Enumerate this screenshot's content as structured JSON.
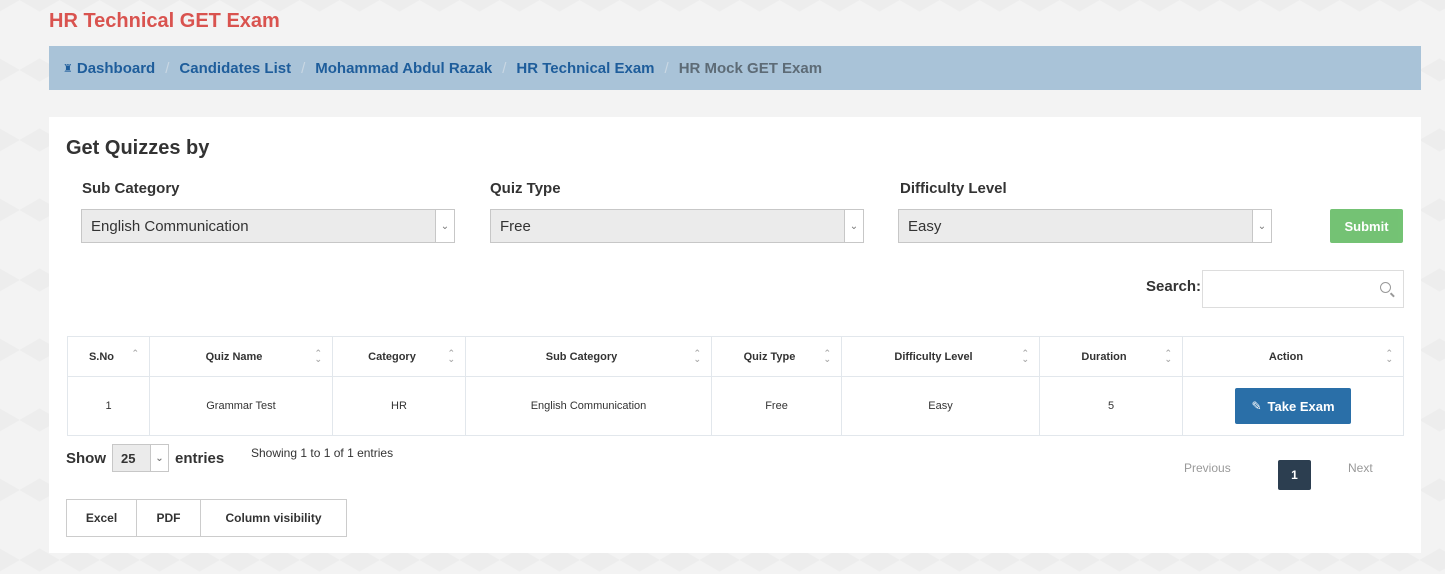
{
  "page": {
    "title": "HR Technical GET Exam"
  },
  "breadcrumb": {
    "items": [
      "Dashboard",
      "Candidates List",
      "Mohammad Abdul Razak",
      "HR Technical Exam"
    ],
    "active": "HR Mock GET Exam"
  },
  "filters": {
    "heading": "Get Quizzes by",
    "sub_category": {
      "label": "Sub Category",
      "value": "English Communication"
    },
    "quiz_type": {
      "label": "Quiz Type",
      "value": "Free"
    },
    "difficulty": {
      "label": "Difficulty Level",
      "value": "Easy"
    },
    "submit_label": "Submit"
  },
  "search": {
    "label": "Search:",
    "value": ""
  },
  "table": {
    "headers": [
      "S.No",
      "Quiz Name",
      "Category",
      "Sub Category",
      "Quiz Type",
      "Difficulty Level",
      "Duration",
      "Action"
    ],
    "rows": [
      {
        "sno": "1",
        "quiz_name": "Grammar Test",
        "category": "HR",
        "sub_category": "English Communication",
        "quiz_type": "Free",
        "difficulty": "Easy",
        "duration": "5",
        "action": "Take Exam"
      }
    ]
  },
  "footer": {
    "show_label": "Show",
    "entries_value": "25",
    "entries_label": "entries",
    "info": "Showing 1 to 1 of 1 entries",
    "previous": "Previous",
    "current_page": "1",
    "next": "Next",
    "export": [
      "Excel",
      "PDF",
      "Column visibility"
    ]
  },
  "colors": {
    "title": "#d9534f",
    "breadcrumb_bg": "#a9c3d8",
    "submit": "#5cb85c",
    "take_exam": "#2a6fa8",
    "active_page": "#2c3e50"
  },
  "icons": {
    "home": "home-icon",
    "edit": "edit-icon",
    "search": "search-icon",
    "sort": "sort-icon",
    "caret": "chevron-down-icon"
  }
}
